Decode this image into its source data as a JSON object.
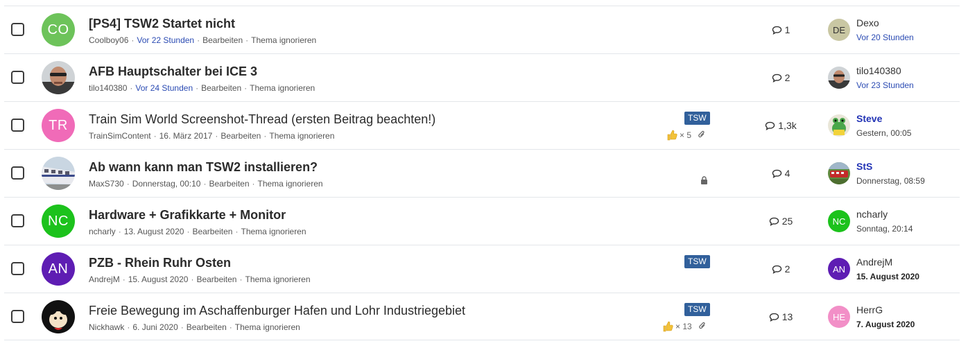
{
  "threads": [
    {
      "avatar_initials": "CO",
      "avatar_color": "#6dc35a",
      "title": "[PS4] TSW2 Startet nicht",
      "unread": true,
      "author": "Coolboy06",
      "date": "Vor 22 Stunden",
      "edit": "Bearbeiten",
      "ignore": "Thema ignorieren",
      "replies": "1",
      "last_initials": "DE",
      "last_avatar_color": "#c9c7a3",
      "last_user": "Dexo",
      "last_time": "Vor 20 Stunden"
    },
    {
      "avatar_photo": "person",
      "title": "AFB Hauptschalter bei ICE 3",
      "unread": true,
      "author": "tilo140380",
      "date": "Vor 24 Stunden",
      "edit": "Bearbeiten",
      "ignore": "Thema ignorieren",
      "replies": "2",
      "last_photo": "person",
      "last_user": "tilo140380",
      "last_time": "Vor 23 Stunden"
    },
    {
      "avatar_initials": "TR",
      "avatar_color": "#f06bb8",
      "title": "Train Sim World Screenshot-Thread (ersten Beitrag beachten!)",
      "unread": false,
      "author": "TrainSimContent",
      "date": "16. März 2017",
      "edit": "Bearbeiten",
      "ignore": "Thema ignorieren",
      "prefix": "TSW",
      "likes": "× 5",
      "replies": "1,3k",
      "last_photo": "frog",
      "last_user": "Steve",
      "last_time": "Gestern, 00:05"
    },
    {
      "avatar_photo": "train",
      "title": "Ab wann kann man TSW2 installieren?",
      "unread": true,
      "author": "MaxS730",
      "date": "Donnerstag, 00:10",
      "edit": "Bearbeiten",
      "ignore": "Thema ignorieren",
      "locked": true,
      "replies": "4",
      "last_photo": "redtrain",
      "last_user": "StS",
      "last_time": "Donnerstag, 08:59"
    },
    {
      "avatar_initials": "NC",
      "avatar_color": "#1cc21c",
      "title": "Hardware + Grafikkarte + Monitor",
      "unread": true,
      "author": "ncharly",
      "date": "13. August 2020",
      "edit": "Bearbeiten",
      "ignore": "Thema ignorieren",
      "replies": "25",
      "last_initials": "NC",
      "last_avatar_color": "#1cc21c",
      "last_user": "ncharly",
      "last_time": "Sonntag, 20:14"
    },
    {
      "avatar_initials": "AN",
      "avatar_color": "#5e1db3",
      "title": "PZB - Rhein Ruhr Osten",
      "unread": true,
      "author": "AndrejM",
      "date": "15. August 2020",
      "edit": "Bearbeiten",
      "ignore": "Thema ignorieren",
      "prefix": "TSW",
      "replies": "2",
      "last_initials": "AN",
      "last_avatar_color": "#5e1db3",
      "last_user": "AndrejM",
      "last_time": "15. August 2020"
    },
    {
      "avatar_photo": "cartoon",
      "title": "Freie Bewegung im Aschaffenburger Hafen und Lohr Industriegebiet",
      "unread": false,
      "author": "Nickhawk",
      "date": "6. Juni 2020",
      "edit": "Bearbeiten",
      "ignore": "Thema ignorieren",
      "prefix": "TSW",
      "likes": "× 13",
      "replies": "13",
      "last_initials": "HE",
      "last_avatar_color": "#f28fc7",
      "last_user": "HerrG",
      "last_time": "7. August 2020"
    }
  ]
}
